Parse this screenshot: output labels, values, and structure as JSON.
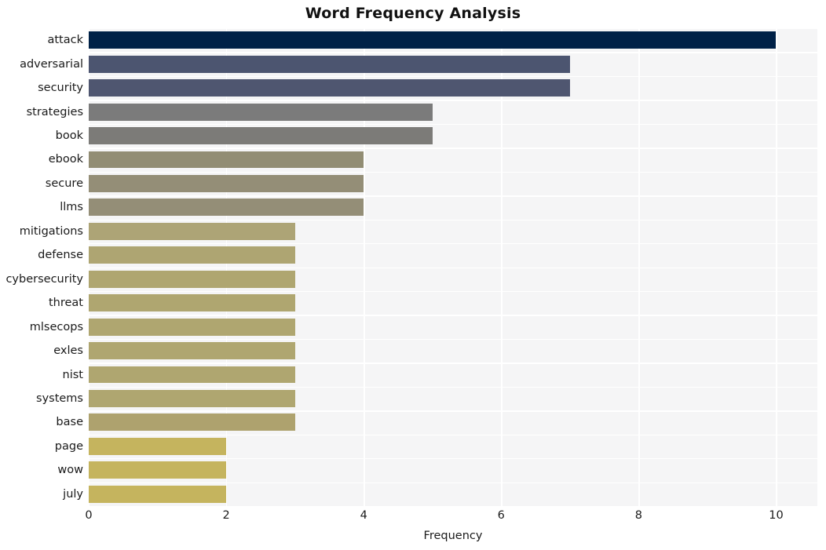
{
  "chart_data": {
    "type": "bar",
    "orientation": "horizontal",
    "title": "Word Frequency Analysis",
    "xlabel": "Frequency",
    "ylabel": "",
    "categories": [
      "attack",
      "adversarial",
      "security",
      "strategies",
      "book",
      "ebook",
      "secure",
      "llms",
      "mitigations",
      "defense",
      "cybersecurity",
      "threat",
      "mlsecops",
      "exles",
      "nist",
      "systems",
      "base",
      "page",
      "wow",
      "july"
    ],
    "values": [
      10,
      7,
      7,
      5,
      5,
      4,
      4,
      4,
      3,
      3,
      3,
      3,
      3,
      3,
      3,
      3,
      3,
      2,
      2,
      2
    ],
    "xlim": [
      0,
      10.6
    ],
    "xticks": [
      0,
      2,
      4,
      6,
      8,
      10
    ],
    "xtick_labels": [
      "0",
      "2",
      "4",
      "6",
      "8",
      "10"
    ],
    "grid": true,
    "legend": false,
    "bar_colors": [
      "#002147",
      "#4c5570",
      "#4f5670",
      "#7b7b7b",
      "#7c7b78",
      "#928d74",
      "#948e77",
      "#948e77",
      "#ada476",
      "#aea572",
      "#afa670",
      "#afa670",
      "#afa670",
      "#afa670",
      "#afa670",
      "#afa670",
      "#aea26e",
      "#c5b45e",
      "#c5b45e",
      "#c5b45e"
    ],
    "plot_background": "#f5f5f6",
    "gridline_color": "#ffffff",
    "figure_background": "#ffffff",
    "text_color": "#1a1a1a"
  }
}
